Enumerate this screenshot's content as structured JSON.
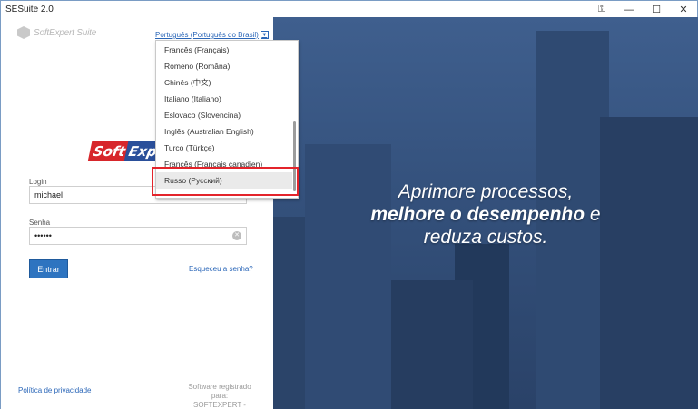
{
  "window": {
    "title": "SESuite 2.0",
    "controls": [
      "key-icon",
      "minimize-icon",
      "maximize-icon",
      "close-icon"
    ]
  },
  "brand": {
    "name": "SoftExpert Suite"
  },
  "language": {
    "selected": "Português (Português do Brasil)"
  },
  "dropdown": {
    "items": [
      "Francês (Français)",
      "Romeno (Româna)",
      "Chinês (中文)",
      "Italiano (Italiano)",
      "Eslovaco (Slovencina)",
      "Inglês (Australian English)",
      "Turco (Türkçe)",
      "Francês (Français canadien)",
      "Russo (Русский)"
    ],
    "highlighted_index": 8
  },
  "logo": {
    "part1": "Soft",
    "part2": "Expert"
  },
  "form": {
    "login_label": "Login",
    "login_value": "michael",
    "password_label": "Senha",
    "password_value": "••••••",
    "submit_label": "Entrar",
    "forgot_label": "Esqueceu a senha?"
  },
  "footer": {
    "privacy_label": "Política de privacidade",
    "registered_line1": "Software registrado para:",
    "registered_line2": "SOFTEXPERT - DEMO"
  },
  "hero": {
    "line1": "Aprimore processos,",
    "line2_bold": "melhore o desempenho",
    "line2_rest": " e",
    "line3": "reduza custos."
  },
  "colors": {
    "accent": "#2e74c0",
    "highlight_border": "#e3242b",
    "hero_bg": "#34517c"
  }
}
